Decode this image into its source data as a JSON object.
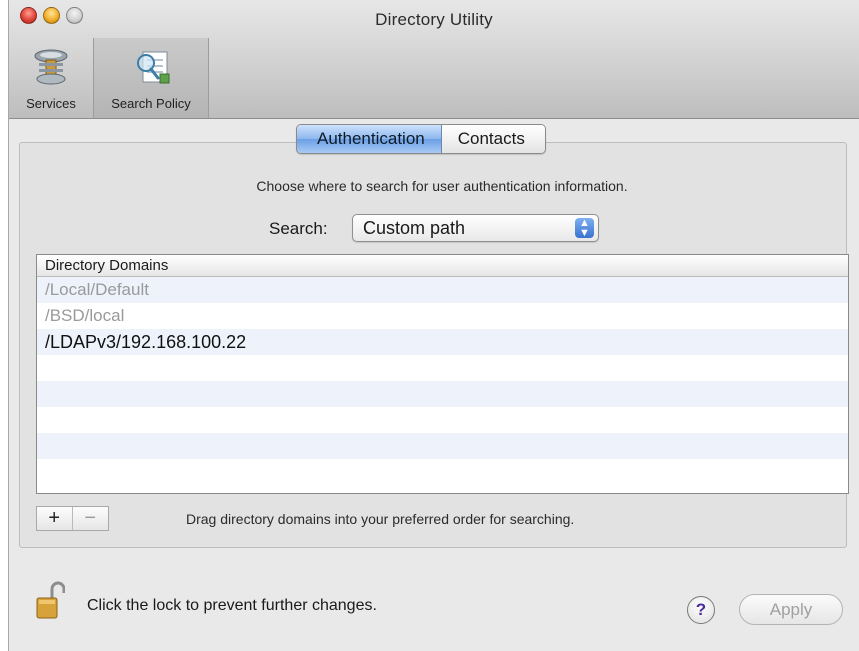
{
  "window": {
    "title": "Directory Utility"
  },
  "toolbar": {
    "items": [
      {
        "label": "Services",
        "icon": "services-icon"
      },
      {
        "label": "Search Policy",
        "icon": "search-policy-icon",
        "selected": true
      }
    ]
  },
  "tabs": [
    {
      "label": "Authentication",
      "selected": true
    },
    {
      "label": "Contacts",
      "selected": false
    }
  ],
  "description": "Choose where to search for user authentication information.",
  "search": {
    "label": "Search:",
    "value": "Custom path"
  },
  "domains": {
    "header": "Directory Domains",
    "rows": [
      "/Local/Default",
      "/BSD/local",
      "/LDAPv3/192.168.100.22"
    ]
  },
  "buttons": {
    "add": "+",
    "remove": "−",
    "help": "?",
    "apply": "Apply"
  },
  "hint": "Drag directory domains into your preferred order for searching.",
  "lock_text": "Click the lock to prevent further changes.",
  "colors": {
    "selection_blue": "#6c9fe4",
    "list_stripe": "#edf2fb",
    "lock_gold": "#d8a23a"
  }
}
